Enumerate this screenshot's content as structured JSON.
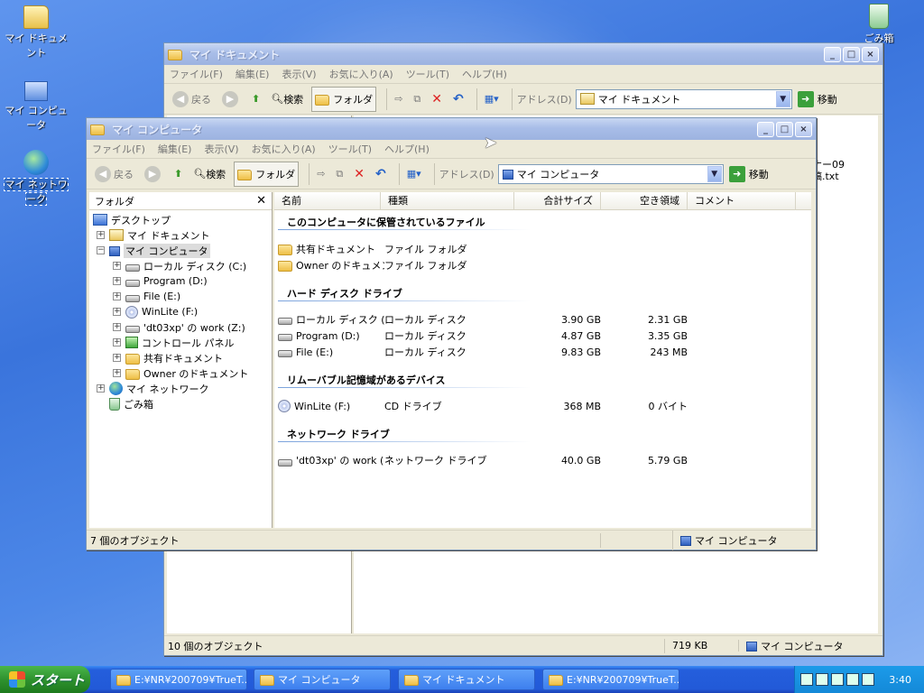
{
  "desktop": {
    "icons": [
      {
        "label": "マイ ドキュメント",
        "icon": "folder-documents-icon"
      },
      {
        "label": "マイ コンピュータ",
        "icon": "computer-icon"
      },
      {
        "label": "マイ ネットワーク",
        "icon": "network-icon"
      },
      {
        "label": "ごみ箱",
        "icon": "recycle-bin-icon"
      }
    ]
  },
  "back_window": {
    "title": "マイ ドキュメント",
    "menu": [
      "ファイル(F)",
      "編集(E)",
      "表示(V)",
      "お気に入り(A)",
      "ツール(T)",
      "ヘルプ(H)"
    ],
    "toolbar": {
      "back": "戻る",
      "search": "検索",
      "folders": "フォルダ",
      "address_label": "アドレス(D)",
      "address_value": "マイ ドキュメント",
      "go": "移動"
    },
    "partial_item": "ナー09\n稿.txt",
    "status": {
      "count": "10 個のオブジェクト",
      "size": "719 KB",
      "zone": "マイ コンピュータ"
    }
  },
  "front_window": {
    "title": "マイ コンピュータ",
    "menu": [
      "ファイル(F)",
      "編集(E)",
      "表示(V)",
      "お気に入り(A)",
      "ツール(T)",
      "ヘルプ(H)"
    ],
    "toolbar": {
      "back": "戻る",
      "search": "検索",
      "folders": "フォルダ",
      "address_label": "アドレス(D)",
      "address_value": "マイ コンピュータ",
      "go": "移動"
    },
    "tree": {
      "header": "フォルダ",
      "items": [
        {
          "label": "デスクトップ",
          "icon": "desktop-icon"
        },
        {
          "label": "マイ ドキュメント",
          "icon": "documents-icon"
        },
        {
          "label": "マイ コンピュータ",
          "icon": "computer-icon"
        },
        {
          "label": "ローカル ディスク (C:)",
          "icon": "drive-icon"
        },
        {
          "label": "Program (D:)",
          "icon": "drive-icon"
        },
        {
          "label": "File (E:)",
          "icon": "drive-icon"
        },
        {
          "label": "WinLite (F:)",
          "icon": "cd-drive-icon"
        },
        {
          "label": "'dt03xp' の work (Z:)",
          "icon": "network-drive-icon"
        },
        {
          "label": "コントロール パネル",
          "icon": "control-panel-icon"
        },
        {
          "label": "共有ドキュメント",
          "icon": "folder-icon"
        },
        {
          "label": "Owner のドキュメント",
          "icon": "folder-icon"
        },
        {
          "label": "マイ ネットワーク",
          "icon": "network-icon"
        },
        {
          "label": "ごみ箱",
          "icon": "recycle-bin-icon"
        }
      ]
    },
    "columns": [
      "名前",
      "種類",
      "合計サイズ",
      "空き領域",
      "コメント"
    ],
    "groups": [
      {
        "title": "このコンピュータに保管されているファイル",
        "rows": [
          {
            "name": "共有ドキュメント",
            "type": "ファイル フォルダ",
            "total": "",
            "free": "",
            "icon": "folder-icon"
          },
          {
            "name": "Owner のドキュメン...",
            "type": "ファイル フォルダ",
            "total": "",
            "free": "",
            "icon": "folder-icon"
          }
        ]
      },
      {
        "title": "ハード ディスク ドライブ",
        "rows": [
          {
            "name": "ローカル ディスク (...",
            "type": "ローカル ディスク",
            "total": "3.90 GB",
            "free": "2.31 GB",
            "icon": "drive-icon"
          },
          {
            "name": "Program (D:)",
            "type": "ローカル ディスク",
            "total": "4.87 GB",
            "free": "3.35 GB",
            "icon": "drive-icon"
          },
          {
            "name": "File (E:)",
            "type": "ローカル ディスク",
            "total": "9.83 GB",
            "free": "243 MB",
            "icon": "drive-icon"
          }
        ]
      },
      {
        "title": "リムーバブル記憶域があるデバイス",
        "rows": [
          {
            "name": "WinLite (F:)",
            "type": "CD ドライブ",
            "total": "368 MB",
            "free": "0 バイト",
            "icon": "cd-drive-icon"
          }
        ]
      },
      {
        "title": "ネットワーク ドライブ",
        "rows": [
          {
            "name": "'dt03xp' の work (...",
            "type": "ネットワーク ドライブ",
            "total": "40.0 GB",
            "free": "5.79 GB",
            "icon": "network-drive-icon"
          }
        ]
      }
    ],
    "status": {
      "count": "7 個のオブジェクト",
      "zone": "マイ コンピュータ"
    }
  },
  "taskbar": {
    "start": "スタート",
    "tasks": [
      "E:¥NR¥200709¥TrueT...",
      "マイ コンピュータ",
      "マイ ドキュメント",
      "E:¥NR¥200709¥TrueT..."
    ],
    "clock": "3:40"
  }
}
